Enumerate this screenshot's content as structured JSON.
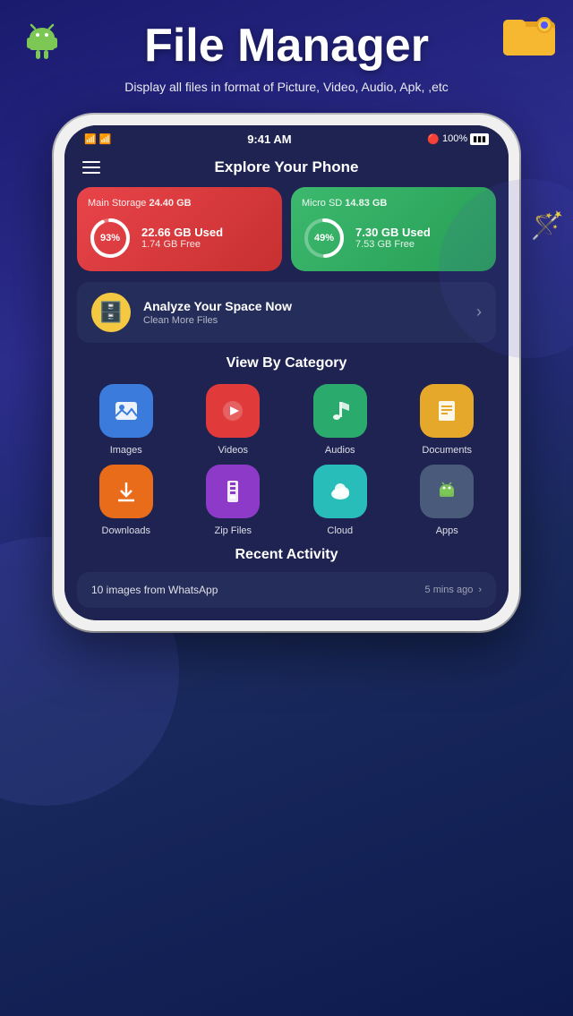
{
  "app": {
    "title": "File Manager",
    "subtitle": "Display all files in format of Picture, Video, Audio, Apk, ,etc"
  },
  "topbar": {
    "title": "Explore Your Phone",
    "hamburger_label": "Menu"
  },
  "statusbar": {
    "time": "9:41 AM",
    "battery": "100%"
  },
  "storage": {
    "main": {
      "label": "Main Storage",
      "total": "24.40 GB",
      "used": "22.66 GB Used",
      "free": "1.74 GB Free",
      "percent": "93%",
      "percent_num": 93
    },
    "micro": {
      "label": "Micro SD",
      "total": "14.83 GB",
      "used": "7.30 GB Used",
      "free": "7.53 GB Free",
      "percent": "49%",
      "percent_num": 49
    }
  },
  "analyze": {
    "title": "Analyze Your Space Now",
    "subtitle": "Clean More Files"
  },
  "categories": {
    "section_title": "View By Category",
    "items": [
      {
        "label": "Images",
        "icon": "🖼️",
        "color": "bg-blue"
      },
      {
        "label": "Videos",
        "icon": "▶️",
        "color": "bg-red"
      },
      {
        "label": "Audios",
        "icon": "🎵",
        "color": "bg-green"
      },
      {
        "label": "Documents",
        "icon": "📄",
        "color": "bg-yellow"
      },
      {
        "label": "Downloads",
        "icon": "⬇️",
        "color": "bg-orange"
      },
      {
        "label": "Zip Files",
        "icon": "🗜️",
        "color": "bg-purple"
      },
      {
        "label": "Cloud",
        "icon": "☁️",
        "color": "bg-teal"
      },
      {
        "label": "Apps",
        "icon": "🤖",
        "color": "bg-gray"
      }
    ]
  },
  "recent": {
    "section_title": "Recent Activity",
    "item": {
      "text": "10 images from WhatsApp",
      "time": "5 mins ago"
    }
  }
}
